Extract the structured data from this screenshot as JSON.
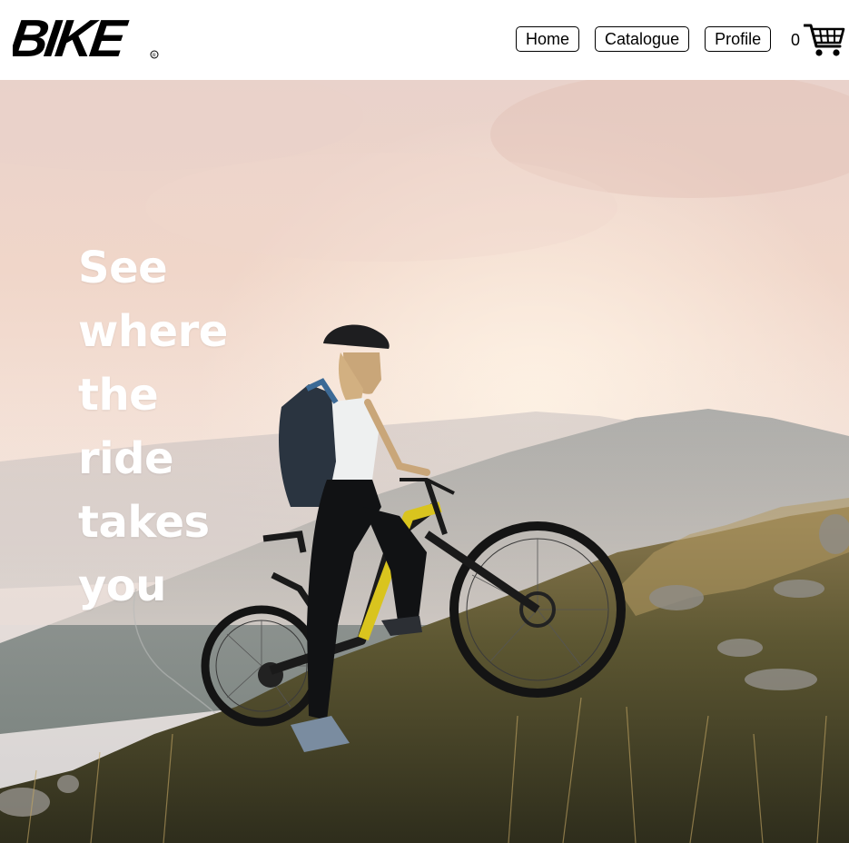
{
  "header": {
    "logo_text": "BIKE",
    "nav": [
      {
        "label": "Home"
      },
      {
        "label": "Catalogue"
      },
      {
        "label": "Profile"
      }
    ],
    "cart": {
      "count": "0",
      "icon": "shopping-cart-icon"
    }
  },
  "hero": {
    "heading_lines": [
      "See",
      "where",
      "the",
      "ride",
      "takes",
      "you"
    ],
    "image": "cyclist-on-mountain-ridge-at-sunset",
    "colors": {
      "sky_top": "#f1d9cf",
      "sky_mid": "#f6e6dc",
      "mountain": "#9fa3a1",
      "grass": "#6b5a32"
    }
  }
}
